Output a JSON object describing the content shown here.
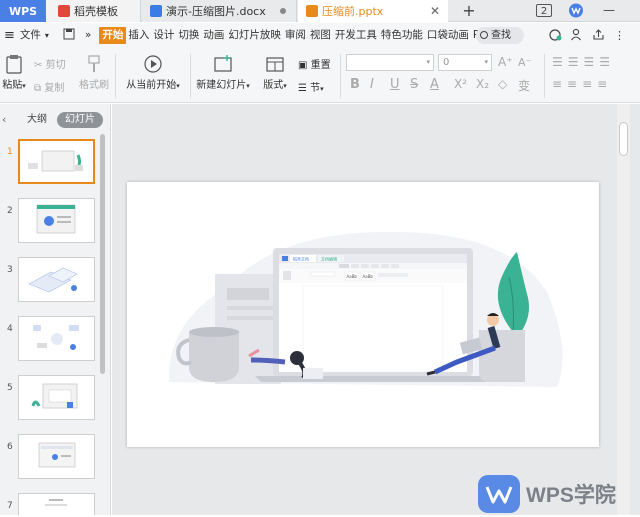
{
  "titlebar": {
    "app_tab": "WPS",
    "tabs": [
      {
        "label": "稻壳模板"
      },
      {
        "label": "演示-压缩图片.docx"
      },
      {
        "label": "压缩前.pptx"
      }
    ],
    "add_tab": "+",
    "page_count_badge": "2"
  },
  "menubar": {
    "file_label": "文件",
    "more": "»",
    "items": [
      "开始",
      "插入",
      "设计",
      "切换",
      "动画",
      "幻灯片放映",
      "审阅",
      "视图",
      "开发工具",
      "特色功能",
      "口袋动画",
      "PA"
    ],
    "search_label": "查找"
  },
  "ribbon": {
    "paste": "粘贴",
    "cut": "剪切",
    "copy": "复制",
    "format_painter": "格式刷",
    "start_from_current": "从当前开始",
    "new_slide": "新建幻灯片",
    "layout": "版式",
    "section": "节",
    "reset": "重置",
    "font_size": "0",
    "bold": "B",
    "italic": "I",
    "underline": "U",
    "strike": "S",
    "font_color": "A",
    "text_case": "变"
  },
  "leftpanel": {
    "outline_tab": "大纲",
    "slides_tab": "幻灯片",
    "thumbnails": [
      "1",
      "2",
      "3",
      "4",
      "5",
      "6",
      "7"
    ]
  },
  "slide": {
    "mock_tab1": "稻壳文档",
    "mock_tab2": "文档编辑",
    "mock_style1": "AaBb",
    "mock_style2": "AaBb"
  },
  "watermark": {
    "text": "WPS学院"
  },
  "colors": {
    "accent": "#e8891b",
    "brand_blue": "#4a80e6",
    "wps_red": "#e0493a",
    "doc_blue": "#3c7be6",
    "teal": "#3ab294"
  }
}
